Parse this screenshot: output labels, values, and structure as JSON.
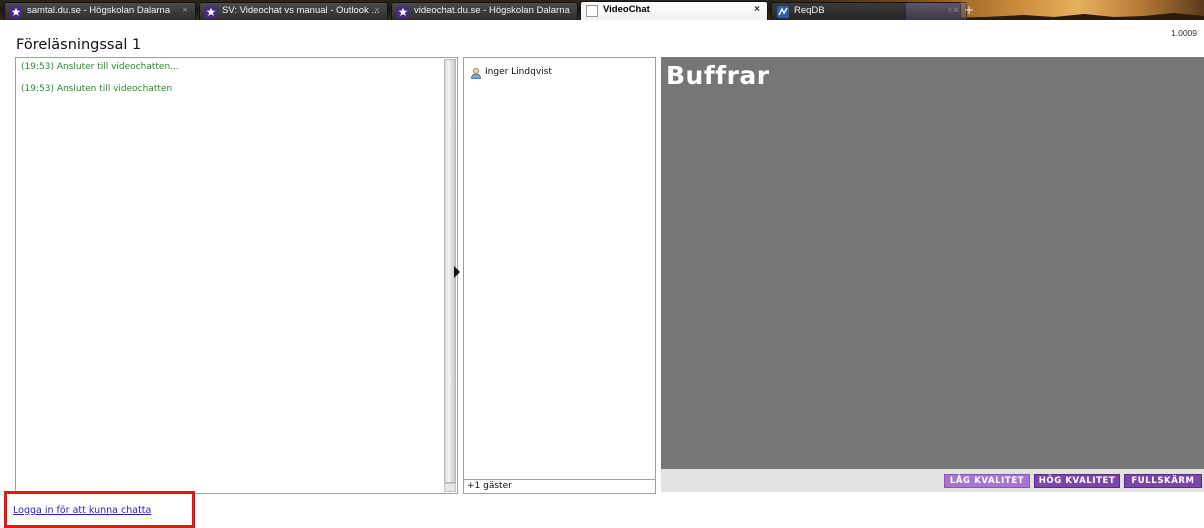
{
  "browser": {
    "tabs": [
      {
        "title": "samtal.du.se - Högskolan Dalarna",
        "icon": "star-favicon-icon",
        "active": false
      },
      {
        "title": "SV: Videochat vs manual - Outlook ...",
        "icon": "star-favicon-icon",
        "active": false
      },
      {
        "title": "videochat.du.se - Högskolan Dalarna",
        "icon": "star-favicon-icon",
        "active": false
      },
      {
        "title": "VideoChat",
        "icon": "page-icon",
        "active": true
      },
      {
        "title": "ReqDB",
        "icon": "reqdb-favicon-icon",
        "active": false
      },
      {
        "title": "",
        "icon": "",
        "active": false
      }
    ],
    "close_glyph": "×",
    "new_tab_glyph": "+"
  },
  "page": {
    "version": "1.0009",
    "room_title": "Föreläsningssal 1"
  },
  "chat": {
    "messages": [
      {
        "text": "(19:53) Ansluter till videochatten..."
      },
      {
        "text": "(19:53) Ansluten till videochatten"
      }
    ]
  },
  "users": {
    "list": [
      {
        "name": "Inger Lindqvist",
        "icon": "user-icon"
      }
    ],
    "guests": "+1 gäster"
  },
  "video": {
    "status": "Buffrar",
    "buttons": [
      {
        "label": "LÅG KVALITET",
        "selected": true
      },
      {
        "label": "HÖG KVALITET",
        "selected": false
      },
      {
        "label": "FULLSKÄRM",
        "selected": false
      }
    ]
  },
  "login": {
    "link_text": "Logga in för att kunna chatta"
  },
  "colors": {
    "chat_text": "#2a8a2a",
    "video_bg": "#767676",
    "button_purple": "#7c45a8",
    "button_selected": "#a774d1",
    "highlight_red": "#ee1111",
    "link_blue": "#2222cc"
  }
}
